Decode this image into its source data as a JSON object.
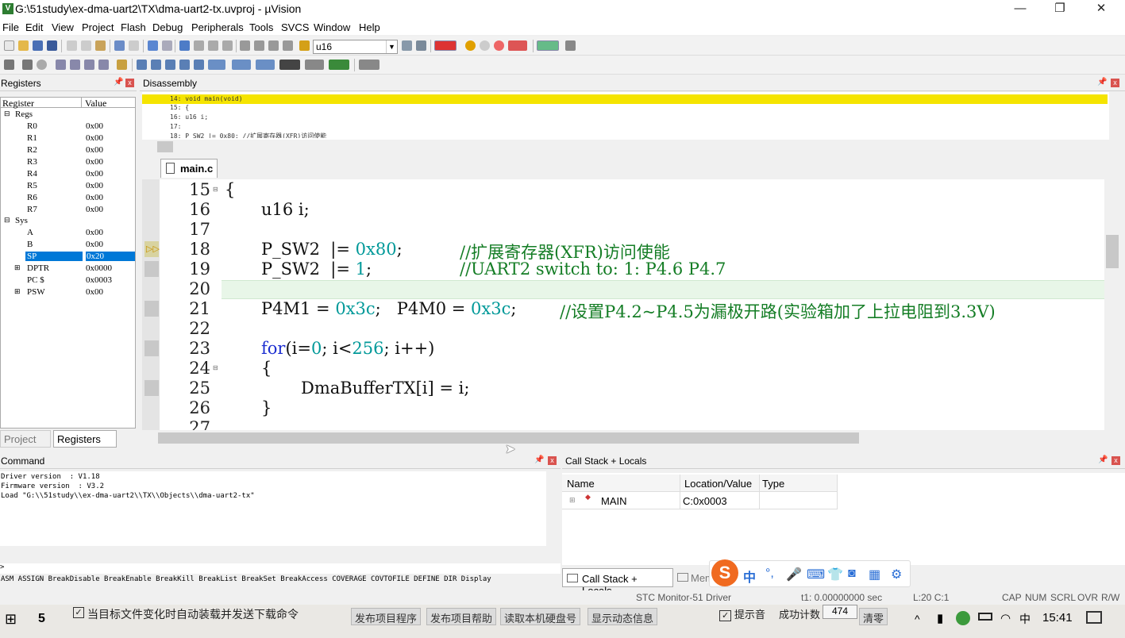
{
  "window": {
    "title": "G:\\51study\\ex-dma-uart2\\TX\\dma-uart2-tx.uvproj - µVision",
    "minimize_icon": "—",
    "maximize_icon": "❐",
    "close_icon": "✕"
  },
  "menu": [
    "File",
    "Edit",
    "View",
    "Project",
    "Flash",
    "Debug",
    "Peripherals",
    "Tools",
    "SVCS",
    "Window",
    "Help"
  ],
  "toolbar": {
    "combo_value": "u16"
  },
  "registers_panel": {
    "title": "Registers",
    "col_register": "Register",
    "col_value": "Value",
    "groups": {
      "regs": "Regs",
      "sys": "Sys"
    },
    "rows": [
      {
        "name": "R0",
        "value": "0x00"
      },
      {
        "name": "R1",
        "value": "0x00"
      },
      {
        "name": "R2",
        "value": "0x00"
      },
      {
        "name": "R3",
        "value": "0x00"
      },
      {
        "name": "R4",
        "value": "0x00"
      },
      {
        "name": "R5",
        "value": "0x00"
      },
      {
        "name": "R6",
        "value": "0x00"
      },
      {
        "name": "R7",
        "value": "0x00"
      }
    ],
    "sys_rows": [
      {
        "name": "A",
        "value": "0x00"
      },
      {
        "name": "B",
        "value": "0x00"
      },
      {
        "name": "SP",
        "value": "0x20"
      },
      {
        "name": "DPTR",
        "value": "0x0000"
      },
      {
        "name": "PC $",
        "value": "0x0003"
      },
      {
        "name": "PSW",
        "value": "0x00"
      }
    ],
    "tabs": {
      "project": "Project",
      "registers": "Registers"
    }
  },
  "disassembly": {
    "title": "Disassembly",
    "lines": [
      "14: void main(void)",
      "15: {",
      "16:         u16 i;",
      "17:",
      "18:     P_SW2 |= 0x80;      //扩展寄存器(XFR)访问使能"
    ]
  },
  "editor": {
    "tab": "main.c",
    "line_numbers": [
      "15",
      "16",
      "17",
      "18",
      "19",
      "20",
      "21",
      "22",
      "23",
      "24",
      "25",
      "26",
      "27"
    ],
    "lines": {
      "l15": "{",
      "l16": "u16 i;",
      "l18a": "P_SW2  |= ",
      "l18b": "0x80",
      "l18c": ";",
      "l18d": "//扩展寄存器(XFR)访问使能",
      "l19a": "P_SW2  |= ",
      "l19b": "1",
      "l19c": ";",
      "l19d": "//UART2 switch to: 1: P4.6 P4.7",
      "l21a": "P4M1 = ",
      "l21b": "0x3c",
      "l21c": ";   P4M0 = ",
      "l21d": "0x3c",
      "l21e": ";",
      "l21f": "//设置P4.2~P4.5为漏极开路(实验箱加了上拉电阻到3.3V)",
      "l23a": "for",
      "l23b": "(i=",
      "l23c": "0",
      "l23d": "; i<",
      "l23e": "256",
      "l23f": "; i++)",
      "l24": "{",
      "l25": "DmaBufferTX[i] = i;",
      "l26": "}"
    }
  },
  "command": {
    "title": "Command",
    "output": [
      "Driver version  : V1.18",
      "Firmware version  : V3.2",
      "Load \"G:\\\\51study\\\\ex-dma-uart2\\\\TX\\\\Objects\\\\dma-uart2-tx\""
    ],
    "prompt": ">",
    "help": "ASM ASSIGN BreakDisable BreakEnable BreakKill BreakList BreakSet BreakAccess COVERAGE COVTOFILE DEFINE DIR Display"
  },
  "callstack": {
    "title": "Call Stack + Locals",
    "col_name": "Name",
    "col_location": "Location/Value",
    "col_type": "Type",
    "row": {
      "name": "MAIN",
      "location": "C:0x0003",
      "type": ""
    },
    "tab_callstack": "Call Stack + Locals",
    "tab_memory": "Mem"
  },
  "ime": {
    "lang": "中",
    "punct": "°,"
  },
  "status": {
    "driver": "STC Monitor-51 Driver",
    "time": "t1: 0.00000000 sec",
    "pos": "L:20 C:1",
    "caps": "CAP",
    "num": "NUM",
    "scrl": "SCRL",
    "ovr": "OVR",
    "rw": "R/W"
  },
  "taskbar": {
    "checkbox_label": "当目标文件变化时自动装载并发送下载命令",
    "btn1": "发布项目程序",
    "btn2": "发布项目帮助",
    "btn3": "读取本机硬盘号",
    "btn4": "显示动态信息",
    "hint": "提示音",
    "count_label": "成功计数",
    "count_value": "474",
    "clear": "清零",
    "clock": "15:41"
  },
  "colors": {
    "accent": "#0078d7",
    "highlight": "#f5e400",
    "keyword": "#1d2fd1",
    "number": "#009999",
    "comment": "#147d25"
  }
}
